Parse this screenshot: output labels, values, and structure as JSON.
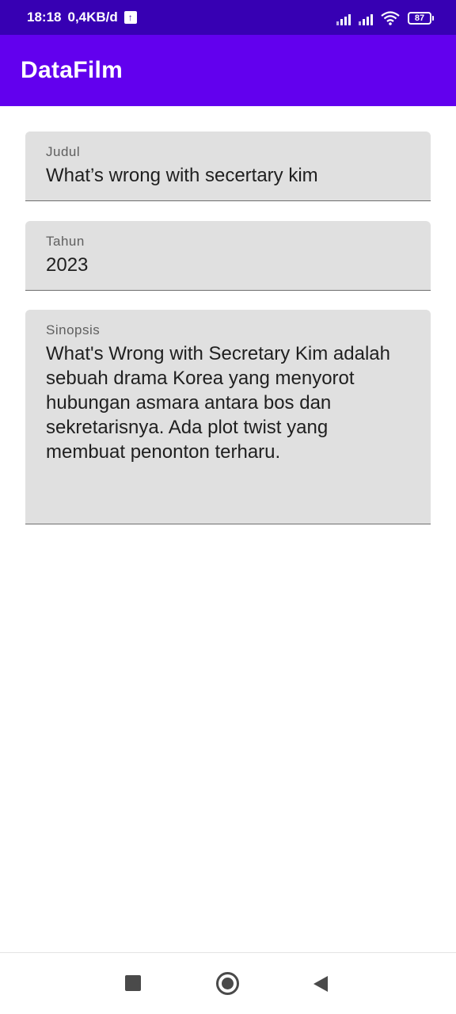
{
  "status_bar": {
    "time": "18:18",
    "net_speed": "0,4KB/d",
    "battery": "87"
  },
  "app_bar": {
    "title": "DataFilm",
    "color": "#6200ee"
  },
  "form": {
    "judul": {
      "label": "Judul",
      "value": "What’s wrong with secertary kim"
    },
    "tahun": {
      "label": "Tahun",
      "value": "2023"
    },
    "sinopsis": {
      "label": "Sinopsis",
      "lines": [
        "What's Wrong with Secretary Kim adalah",
        "sebuah drama Korea yang menyorot",
        "hubungan asmara antara bos dan",
        "sekretarisnya. Ada plot twist yang",
        "membuat penonton terharu."
      ]
    }
  },
  "nav": {
    "icons": [
      "recents-icon",
      "home-icon",
      "back-icon"
    ]
  }
}
